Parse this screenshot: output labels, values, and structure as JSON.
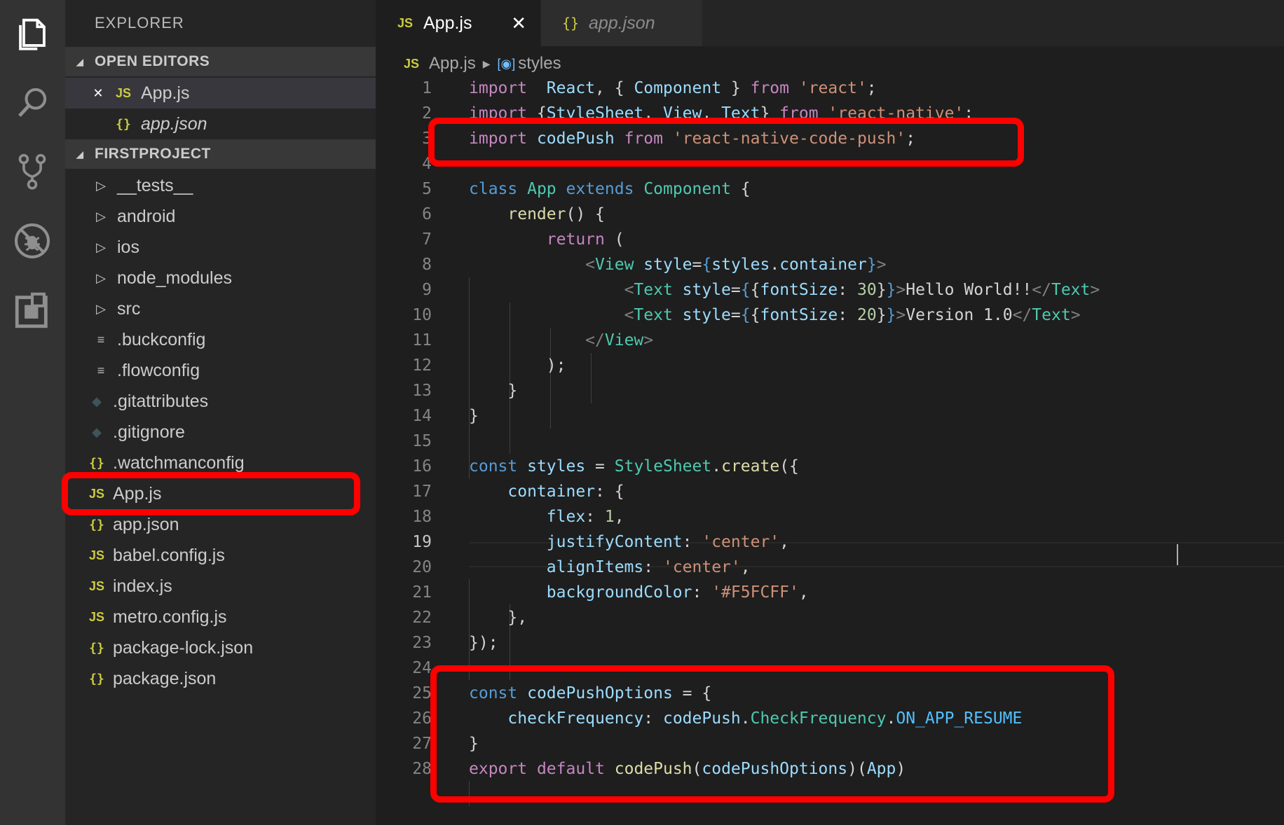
{
  "activity_bar": {
    "icons": [
      "explorer-icon",
      "search-icon",
      "source-control-icon",
      "debug-icon",
      "extensions-icon"
    ]
  },
  "sidebar": {
    "title": "EXPLORER",
    "open_editors": {
      "header": "OPEN EDITORS",
      "items": [
        {
          "label": "App.js",
          "icon": "js"
        },
        {
          "label": "app.json",
          "icon": "json"
        }
      ]
    },
    "project": {
      "header": "FIRSTPROJECT",
      "items": [
        {
          "label": "__tests__",
          "icon": "folder"
        },
        {
          "label": "android",
          "icon": "folder"
        },
        {
          "label": "ios",
          "icon": "folder"
        },
        {
          "label": "node_modules",
          "icon": "folder"
        },
        {
          "label": "src",
          "icon": "folder"
        },
        {
          "label": ".buckconfig",
          "icon": "lines"
        },
        {
          "label": ".flowconfig",
          "icon": "lines"
        },
        {
          "label": ".gitattributes",
          "icon": "git"
        },
        {
          "label": ".gitignore",
          "icon": "git"
        },
        {
          "label": ".watchmanconfig",
          "icon": "json"
        },
        {
          "label": "App.js",
          "icon": "js"
        },
        {
          "label": "app.json",
          "icon": "json"
        },
        {
          "label": "babel.config.js",
          "icon": "js"
        },
        {
          "label": "index.js",
          "icon": "js"
        },
        {
          "label": "metro.config.js",
          "icon": "js"
        },
        {
          "label": "package-lock.json",
          "icon": "json"
        },
        {
          "label": "package.json",
          "icon": "json"
        }
      ]
    }
  },
  "tabs": [
    {
      "label": "App.js",
      "icon": "JS",
      "active": true
    },
    {
      "label": "app.json",
      "icon": "{}",
      "active": false
    }
  ],
  "breadcrumb": {
    "file_icon": "JS",
    "file": "App.js",
    "symbol": "styles"
  },
  "editor": {
    "active_line": 19,
    "line_numbers": [
      "1",
      "2",
      "3",
      "4",
      "5",
      "6",
      "7",
      "8",
      "9",
      "10",
      "11",
      "12",
      "13",
      "14",
      "15",
      "16",
      "17",
      "18",
      "19",
      "20",
      "21",
      "22",
      "23",
      "24",
      "25",
      "26",
      "27",
      "28"
    ],
    "lines": [
      [
        [
          "kw",
          "import"
        ],
        [
          "",
          "  "
        ],
        [
          "vr",
          "React"
        ],
        [
          "",
          ", { "
        ],
        [
          "vr",
          "Component"
        ],
        [
          "",
          " } "
        ],
        [
          "kw",
          "from"
        ],
        [
          "",
          " "
        ],
        [
          "st",
          "'react'"
        ],
        [
          "",
          ";"
        ]
      ],
      [
        [
          "kw",
          "import"
        ],
        [
          "",
          " {"
        ],
        [
          "vr",
          "StyleSheet"
        ],
        [
          "",
          ", "
        ],
        [
          "vr",
          "View"
        ],
        [
          "",
          ", "
        ],
        [
          "vr",
          "Text"
        ],
        [
          "",
          "} "
        ],
        [
          "kw",
          "from"
        ],
        [
          "",
          " "
        ],
        [
          "st",
          "'react-native'"
        ],
        [
          "",
          ";"
        ]
      ],
      [
        [
          "kw",
          "import"
        ],
        [
          "",
          " "
        ],
        [
          "vr",
          "codePush"
        ],
        [
          "",
          " "
        ],
        [
          "kw",
          "from"
        ],
        [
          "",
          " "
        ],
        [
          "st",
          "'react-native-code-push'"
        ],
        [
          "",
          ";"
        ]
      ],
      [],
      [
        [
          "kb",
          "class"
        ],
        [
          "",
          " "
        ],
        [
          "ty",
          "App"
        ],
        [
          "",
          " "
        ],
        [
          "kb",
          "extends"
        ],
        [
          "",
          " "
        ],
        [
          "ty",
          "Component"
        ],
        [
          "",
          " {"
        ]
      ],
      [
        [
          "",
          "    "
        ],
        [
          "fn",
          "render"
        ],
        [
          "",
          "() {"
        ]
      ],
      [
        [
          "",
          "        "
        ],
        [
          "kw",
          "return"
        ],
        [
          "",
          " ("
        ]
      ],
      [
        [
          "",
          "            "
        ],
        [
          "tg",
          "<"
        ],
        [
          "ty",
          "View"
        ],
        [
          "",
          " "
        ],
        [
          "vr",
          "style"
        ],
        [
          "",
          "="
        ],
        [
          "jb",
          "{"
        ],
        [
          "vr",
          "styles"
        ],
        [
          "",
          "."
        ],
        [
          "vr",
          "container"
        ],
        [
          "jb",
          "}"
        ],
        [
          "tg",
          ">"
        ]
      ],
      [
        [
          "",
          "                "
        ],
        [
          "tg",
          "<"
        ],
        [
          "ty",
          "Text"
        ],
        [
          "",
          " "
        ],
        [
          "vr",
          "style"
        ],
        [
          "",
          "="
        ],
        [
          "jb",
          "{"
        ],
        [
          "",
          "{"
        ],
        [
          "vr",
          "fontSize"
        ],
        [
          "",
          ": "
        ],
        [
          "nm",
          "30"
        ],
        [
          "",
          "}"
        ],
        [
          "jb",
          "}"
        ],
        [
          "tg",
          ">"
        ],
        [
          "",
          "Hello World!!"
        ],
        [
          "tg",
          "</"
        ],
        [
          "ty",
          "Text"
        ],
        [
          "tg",
          ">"
        ]
      ],
      [
        [
          "",
          "                "
        ],
        [
          "tg",
          "<"
        ],
        [
          "ty",
          "Text"
        ],
        [
          "",
          " "
        ],
        [
          "vr",
          "style"
        ],
        [
          "",
          "="
        ],
        [
          "jb",
          "{"
        ],
        [
          "",
          "{"
        ],
        [
          "vr",
          "fontSize"
        ],
        [
          "",
          ": "
        ],
        [
          "nm",
          "20"
        ],
        [
          "",
          "}"
        ],
        [
          "jb",
          "}"
        ],
        [
          "tg",
          ">"
        ],
        [
          "",
          "Version 1.0"
        ],
        [
          "tg",
          "</"
        ],
        [
          "ty",
          "Text"
        ],
        [
          "tg",
          ">"
        ]
      ],
      [
        [
          "",
          "            "
        ],
        [
          "tg",
          "</"
        ],
        [
          "ty",
          "View"
        ],
        [
          "tg",
          ">"
        ]
      ],
      [
        [
          "",
          "        "
        ],
        [
          "",
          ");"
        ]
      ],
      [
        [
          "",
          "    "
        ],
        [
          "",
          "}"
        ]
      ],
      [
        [
          "",
          "}"
        ]
      ],
      [],
      [
        [
          "kb",
          "const"
        ],
        [
          "",
          " "
        ],
        [
          "vr",
          "styles"
        ],
        [
          "",
          " = "
        ],
        [
          "ty",
          "StyleSheet"
        ],
        [
          "",
          "."
        ],
        [
          "fn",
          "create"
        ],
        [
          "",
          "({"
        ]
      ],
      [
        [
          "",
          "    "
        ],
        [
          "vr",
          "container"
        ],
        [
          "",
          ": {"
        ]
      ],
      [
        [
          "",
          "        "
        ],
        [
          "vr",
          "flex"
        ],
        [
          "",
          ": "
        ],
        [
          "nm",
          "1"
        ],
        [
          "",
          ","
        ]
      ],
      [
        [
          "",
          "        "
        ],
        [
          "vr",
          "justifyContent"
        ],
        [
          "",
          ": "
        ],
        [
          "st",
          "'center'"
        ],
        [
          "",
          ","
        ]
      ],
      [
        [
          "",
          "        "
        ],
        [
          "vr",
          "alignItems"
        ],
        [
          "",
          ": "
        ],
        [
          "st",
          "'center'"
        ],
        [
          "",
          ","
        ]
      ],
      [
        [
          "",
          "        "
        ],
        [
          "vr",
          "backgroundColor"
        ],
        [
          "",
          ": "
        ],
        [
          "st",
          "'#F5FCFF'"
        ],
        [
          "",
          ","
        ]
      ],
      [
        [
          "",
          "    "
        ],
        [
          "",
          "},"
        ]
      ],
      [
        [
          "",
          "});"
        ]
      ],
      [],
      [
        [
          "kb",
          "const"
        ],
        [
          "",
          " "
        ],
        [
          "vr",
          "codePushOptions"
        ],
        [
          "",
          " = {"
        ]
      ],
      [
        [
          "",
          "    "
        ],
        [
          "vr",
          "checkFrequency"
        ],
        [
          "",
          ": "
        ],
        [
          "vr",
          "codePush"
        ],
        [
          "",
          "."
        ],
        [
          "ty",
          "CheckFrequency"
        ],
        [
          "",
          "."
        ],
        [
          "cn",
          "ON_APP_RESUME"
        ]
      ],
      [
        [
          "",
          "}"
        ]
      ],
      [
        [
          "kw",
          "export"
        ],
        [
          "",
          " "
        ],
        [
          "kw",
          "default"
        ],
        [
          "",
          " "
        ],
        [
          "fn",
          "codePush"
        ],
        [
          "",
          "("
        ],
        [
          "vr",
          "codePushOptions"
        ],
        [
          "",
          ")("
        ],
        [
          "vr",
          "App"
        ],
        [
          "",
          ")"
        ]
      ]
    ]
  },
  "colors": {
    "highlight": "#ff0000",
    "accent_js": "#cbcb41"
  }
}
